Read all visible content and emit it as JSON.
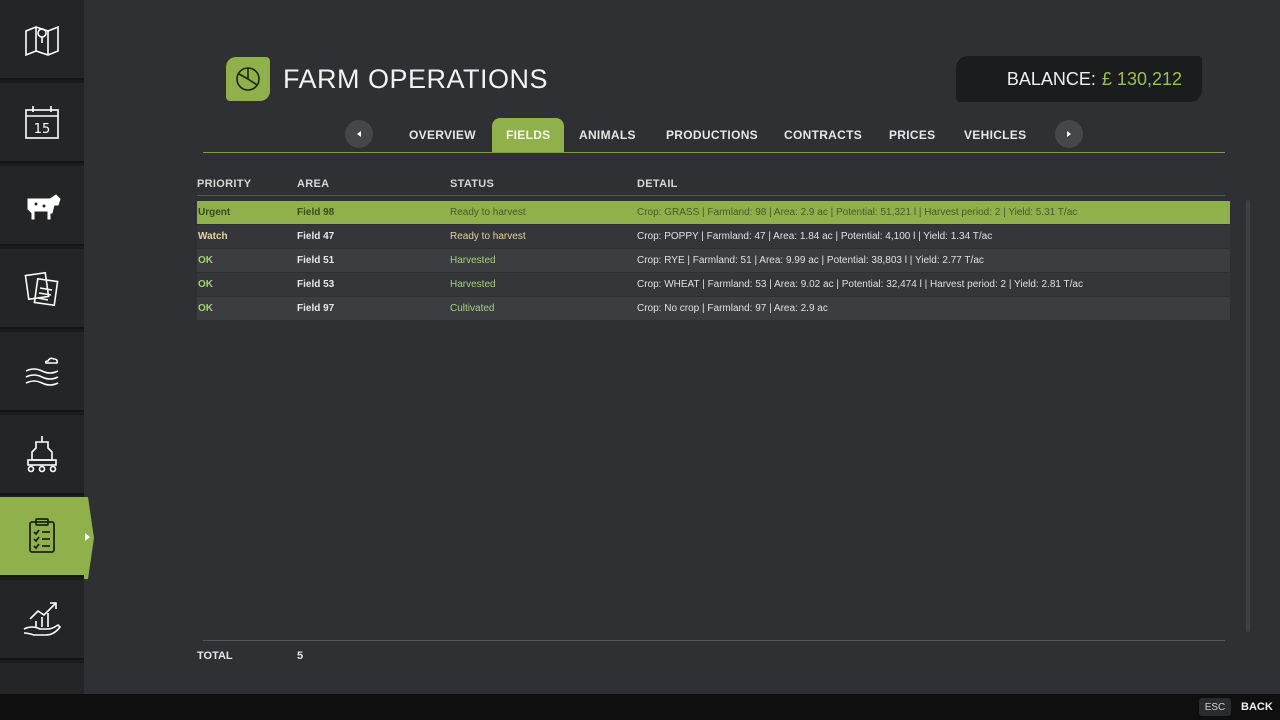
{
  "sidebar": {
    "items": [
      {
        "icon": "map-icon"
      },
      {
        "icon": "calendar-icon",
        "text": "15"
      },
      {
        "icon": "cow-icon"
      },
      {
        "icon": "documents-icon"
      },
      {
        "icon": "weather-icon"
      },
      {
        "icon": "production-icon"
      },
      {
        "icon": "clipboard-icon",
        "active": true
      },
      {
        "icon": "finance-icon"
      },
      {
        "icon": "more-icon"
      }
    ]
  },
  "header": {
    "icon": "pie-chart-icon",
    "title": "FARM OPERATIONS",
    "balance_label": "BALANCE:",
    "balance_value": "£ 130,212"
  },
  "tabs": [
    {
      "label": "OVERVIEW"
    },
    {
      "label": "FIELDS",
      "active": true
    },
    {
      "label": "ANIMALS"
    },
    {
      "label": "PRODUCTIONS"
    },
    {
      "label": "CONTRACTS"
    },
    {
      "label": "PRICES"
    },
    {
      "label": "VEHICLES"
    }
  ],
  "table": {
    "columns": [
      "PRIORITY",
      "AREA",
      "STATUS",
      "DETAIL"
    ],
    "rows": [
      {
        "priority": "Urgent",
        "area": "Field 98",
        "status": "Ready to harvest",
        "detail": "Crop: GRASS | Farmland: 98 | Area: 2.9 ac | Potential: 51,321 l | Harvest period: 2 | Yield: 5.31 T/ac"
      },
      {
        "priority": "Watch",
        "area": "Field 47",
        "status": "Ready to harvest",
        "detail": "Crop: POPPY | Farmland: 47 | Area: 1.84 ac | Potential: 4,100 l | Yield: 1.34 T/ac"
      },
      {
        "priority": "OK",
        "area": "Field 51",
        "status": "Harvested",
        "detail": "Crop: RYE | Farmland: 51 | Area: 9.99 ac | Potential: 38,803 l | Yield: 2.77 T/ac"
      },
      {
        "priority": "OK",
        "area": "Field 53",
        "status": "Harvested",
        "detail": "Crop: WHEAT | Farmland: 53 | Area: 9.02 ac | Potential: 32,474 l | Harvest period: 2 | Yield: 2.81 T/ac"
      },
      {
        "priority": "OK",
        "area": "Field 97",
        "status": "Cultivated",
        "detail": "Crop: No crop | Farmland: 97 | Area: 2.9 ac"
      }
    ]
  },
  "footer": {
    "total_label": "TOTAL",
    "total_value": "5"
  },
  "bottombar": {
    "esc_key": "ESC",
    "back_label": "BACK"
  },
  "colors": {
    "accent": "#8fb04a",
    "balance_value": "#9cbf55",
    "priority_watch": "#e5d39a",
    "priority_ok": "#a5d07a"
  }
}
